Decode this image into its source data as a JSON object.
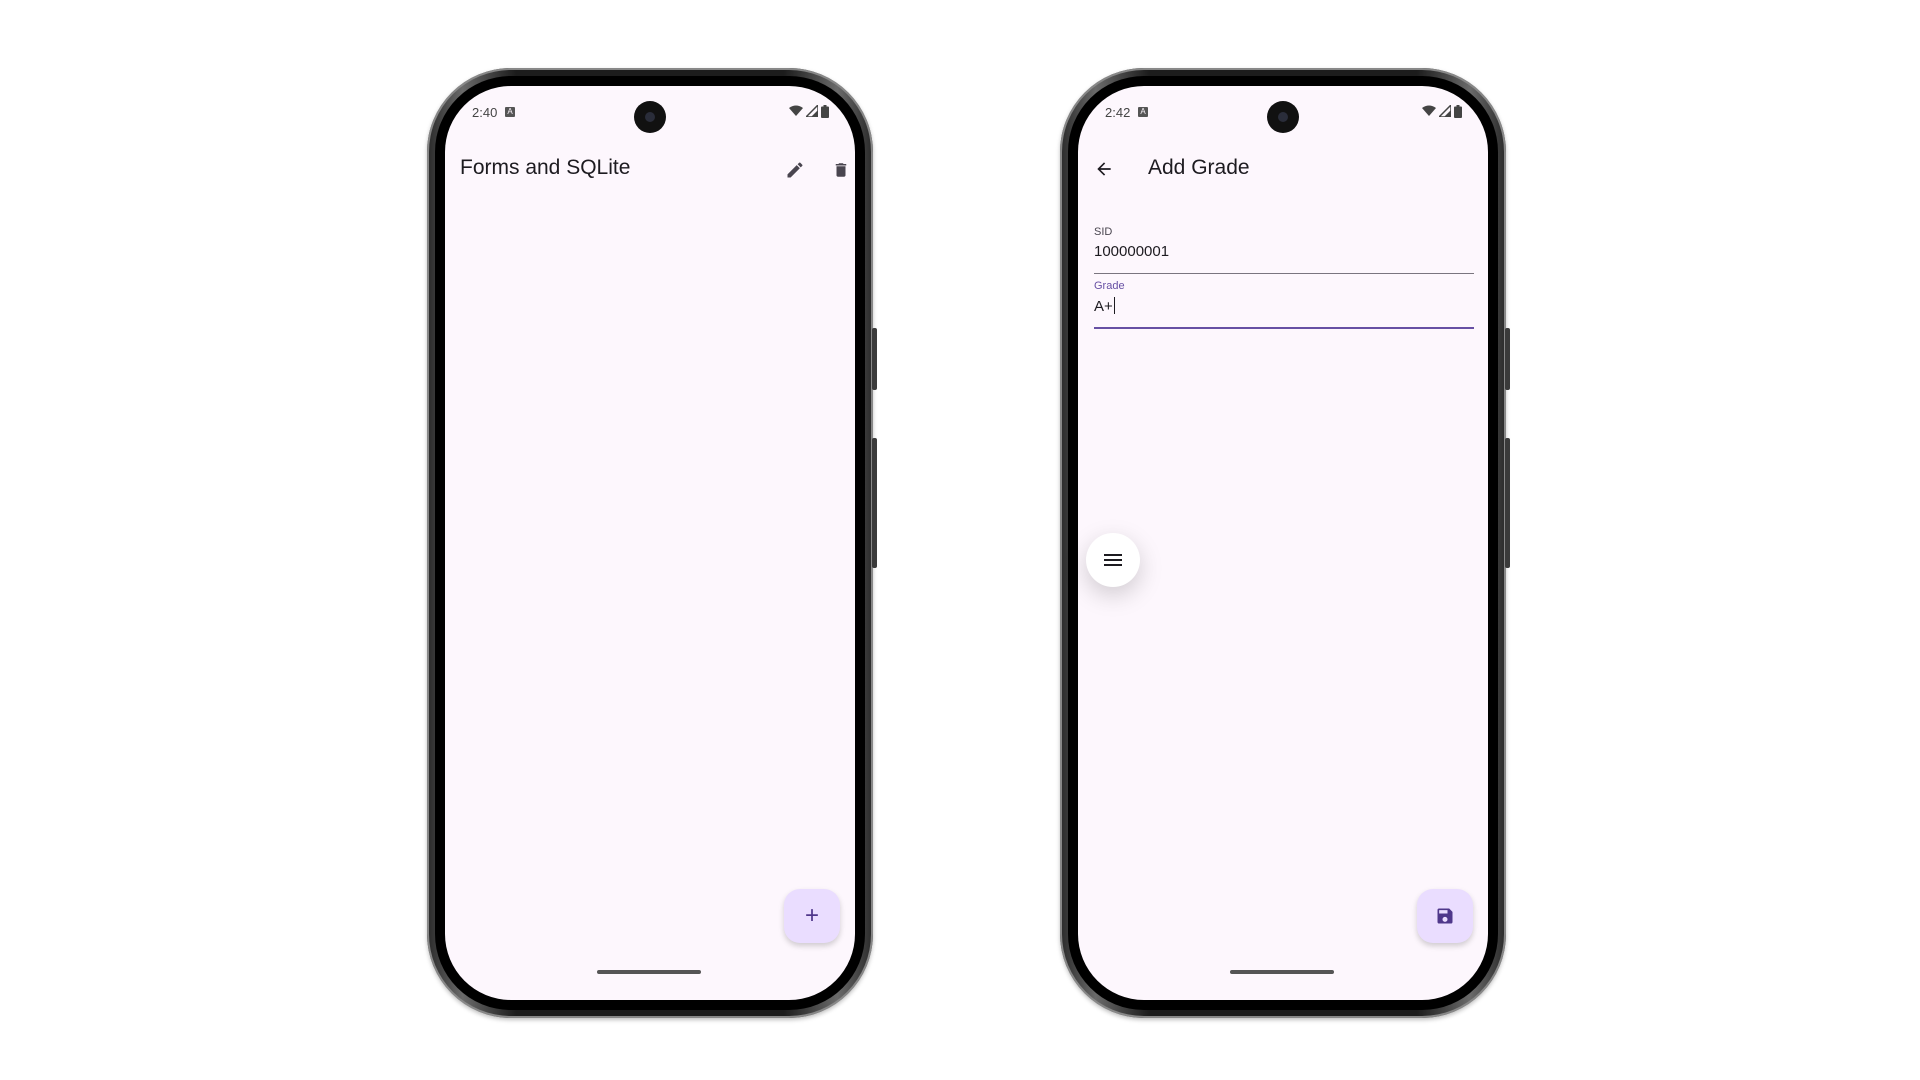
{
  "left_phone": {
    "status": {
      "time": "2:40",
      "notification_badge": "A"
    },
    "app_bar": {
      "title": "Forms and SQLite",
      "actions": [
        "edit-icon",
        "delete-icon"
      ]
    },
    "fab": {
      "icon": "add-icon",
      "label": "+"
    }
  },
  "right_phone": {
    "status": {
      "time": "2:42",
      "notification_badge": "A"
    },
    "app_bar": {
      "title": "Add Grade",
      "leading": "arrow-back-icon"
    },
    "form": {
      "sid": {
        "label": "SID",
        "value": "100000001"
      },
      "grade": {
        "label": "Grade",
        "value": "A+"
      }
    },
    "fab": {
      "icon": "save-icon"
    }
  },
  "floating_button": {
    "icon": "menu-icon"
  },
  "colors": {
    "screen_bg": "#fdf7fd",
    "fab_bg": "#eaddff",
    "accent": "#6750a4",
    "text": "#1d1b20"
  }
}
